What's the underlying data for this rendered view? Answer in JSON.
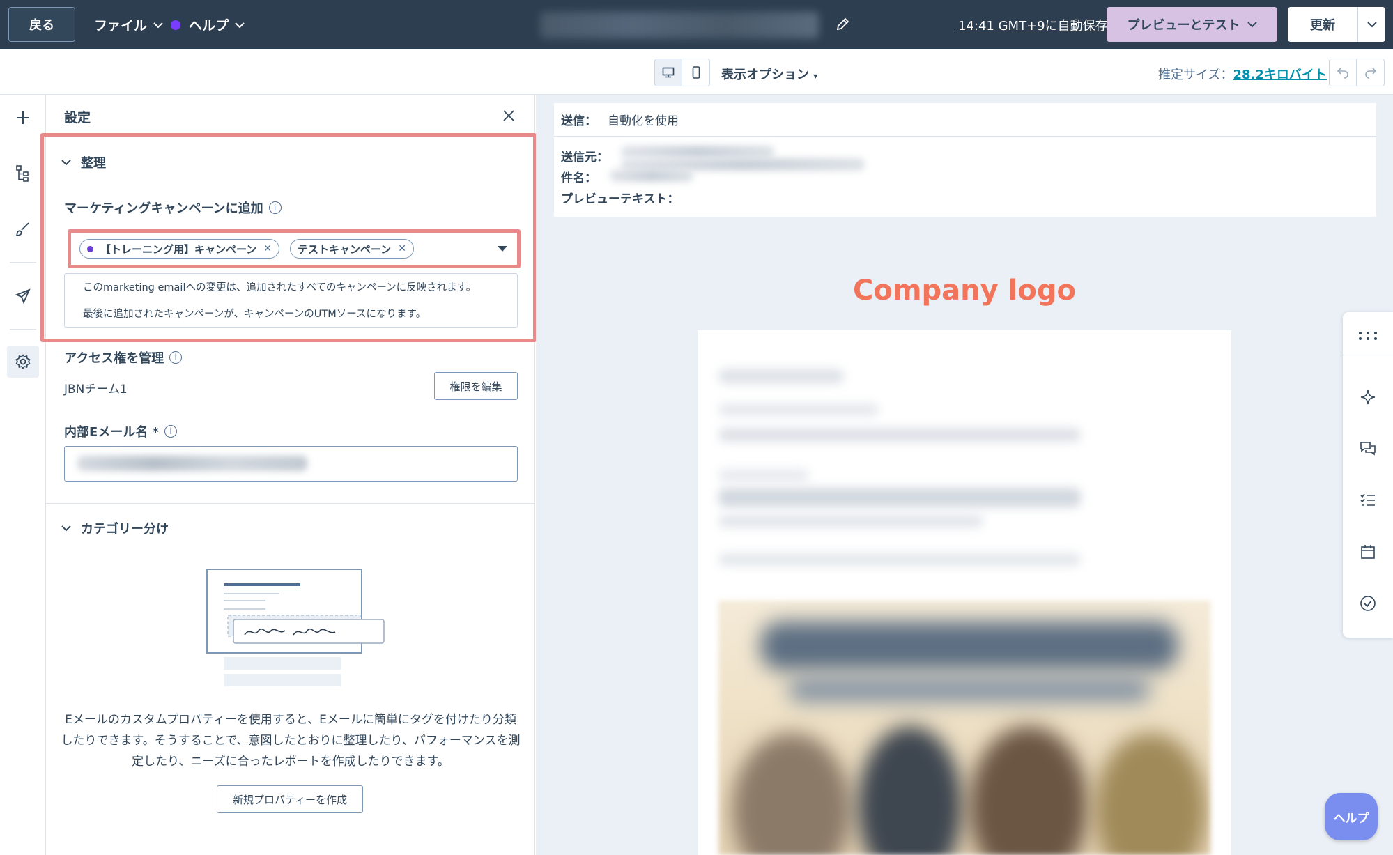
{
  "topbar": {
    "back_label": "戻る",
    "file_menu": "ファイル",
    "help_menu": "ヘルプ",
    "autosave_text": "14:41 GMT+9に自動保存",
    "preview_test_label": "プレビューとテスト",
    "update_label": "更新"
  },
  "toolbar": {
    "display_options": "表示オプション",
    "size_label": "推定サイズ：",
    "size_value": "28.2キロバイト"
  },
  "settings": {
    "title": "設定",
    "organize_section": "整理",
    "campaign_label": "マーケティングキャンペーンに追加",
    "campaigns": [
      {
        "label": "【トレーニング用】キャンペーン"
      },
      {
        "label": "テストキャンペーン"
      }
    ],
    "campaign_notice_1": "このmarketing emailへの変更は、追加されたすべてのキャンペーンに反映されます。",
    "campaign_notice_2": "最後に追加されたキャンペーンが、キャンペーンのUTMソースになります。",
    "access_label": "アクセス権を管理",
    "team_name": "JBNチーム1",
    "edit_permissions": "権限を編集",
    "internal_name_label": "内部Eメール名 *",
    "category_section": "カテゴリー分け",
    "category_desc": "Eメールのカスタムプロパティーを使用すると、Eメールに簡単にタグを付けたり分類したりできます。そうすることで、意図したとおりに整理したり、パフォーマンスを測定したり、ニーズに合ったレポートを作成したりできます。",
    "create_property": "新規プロパティーを作成"
  },
  "preview": {
    "send_label": "送信：",
    "send_value": "自動化を使用",
    "from_label": "送信元：",
    "subject_label": "件名：",
    "preview_text_label": "プレビューテキスト：",
    "logo_text": "Company logo"
  },
  "help_fab": "ヘルプ",
  "colors": {
    "topbar_bg": "#2d3e50",
    "highlight": "#e8898a",
    "preview_button": "#d7c2e4",
    "logo": "#f2745a",
    "link": "#0091ae"
  }
}
